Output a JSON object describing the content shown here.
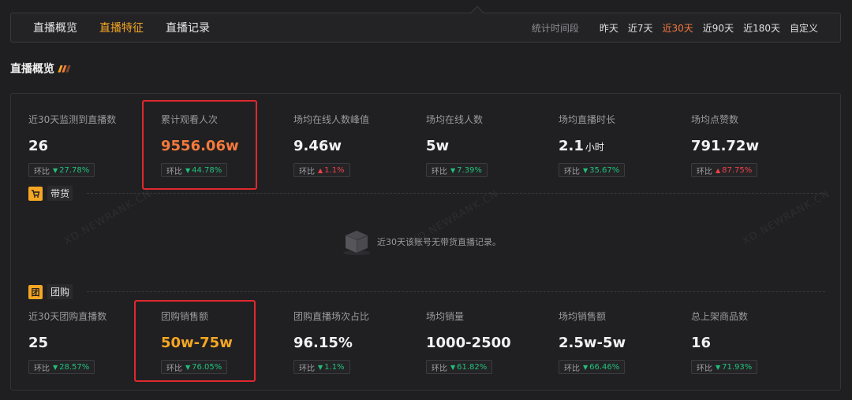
{
  "nav": {
    "tabs": [
      {
        "label": "直播概览",
        "active": false
      },
      {
        "label": "直播特征",
        "active": true
      },
      {
        "label": "直播记录",
        "active": false
      }
    ],
    "range_label": "统计时间段",
    "range_options": [
      {
        "label": "昨天",
        "active": false
      },
      {
        "label": "近7天",
        "active": false
      },
      {
        "label": "近30天",
        "active": true
      },
      {
        "label": "近90天",
        "active": false
      },
      {
        "label": "近180天",
        "active": false
      },
      {
        "label": "自定义",
        "active": false
      }
    ]
  },
  "section_title": "直播概览",
  "overview": {
    "metrics": [
      {
        "label": "近30天监测到直播数",
        "value": "26",
        "unit": "",
        "change_label": "环比",
        "change": "27.78%",
        "direction": "down"
      },
      {
        "label": "累计观看人次",
        "value": "9556.06w",
        "unit": "",
        "change_label": "环比",
        "change": "44.78%",
        "direction": "down"
      },
      {
        "label": "场均在线人数峰值",
        "value": "9.46w",
        "unit": "",
        "change_label": "环比",
        "change": "1.1%",
        "direction": "up"
      },
      {
        "label": "场均在线人数",
        "value": "5w",
        "unit": "",
        "change_label": "环比",
        "change": "7.39%",
        "direction": "down"
      },
      {
        "label": "场均直播时长",
        "value": "2.1",
        "unit": "小时",
        "change_label": "环比",
        "change": "35.67%",
        "direction": "down"
      },
      {
        "label": "场均点赞数",
        "value": "791.72w",
        "unit": "",
        "change_label": "环比",
        "change": "87.75%",
        "direction": "up"
      }
    ]
  },
  "goods": {
    "title": "带货",
    "empty_message": "近30天该账号无带货直播记录。"
  },
  "group": {
    "title": "团购",
    "badge": "团",
    "metrics": [
      {
        "label": "近30天团购直播数",
        "value": "25",
        "unit": "",
        "change_label": "环比",
        "change": "28.57%",
        "direction": "down"
      },
      {
        "label": "团购销售额",
        "value": "50w-75w",
        "unit": "",
        "change_label": "环比",
        "change": "76.05%",
        "direction": "down"
      },
      {
        "label": "团购直播场次占比",
        "value": "96.15%",
        "unit": "",
        "change_label": "环比",
        "change": "1.1%",
        "direction": "down"
      },
      {
        "label": "场均销量",
        "value": "1000-2500",
        "unit": "",
        "change_label": "环比",
        "change": "61.82%",
        "direction": "down"
      },
      {
        "label": "场均销售额",
        "value": "2.5w-5w",
        "unit": "",
        "change_label": "环比",
        "change": "66.46%",
        "direction": "down"
      },
      {
        "label": "总上架商品数",
        "value": "16",
        "unit": "",
        "change_label": "环比",
        "change": "71.93%",
        "direction": "down"
      }
    ]
  },
  "watermark": "XD.NEWRANK.CN",
  "colors": {
    "accent_orange": "#f47a3c",
    "accent_amber": "#f5a623",
    "down_green": "#21c17a",
    "up_red": "#f0414a",
    "highlight_red": "#e0282e"
  }
}
